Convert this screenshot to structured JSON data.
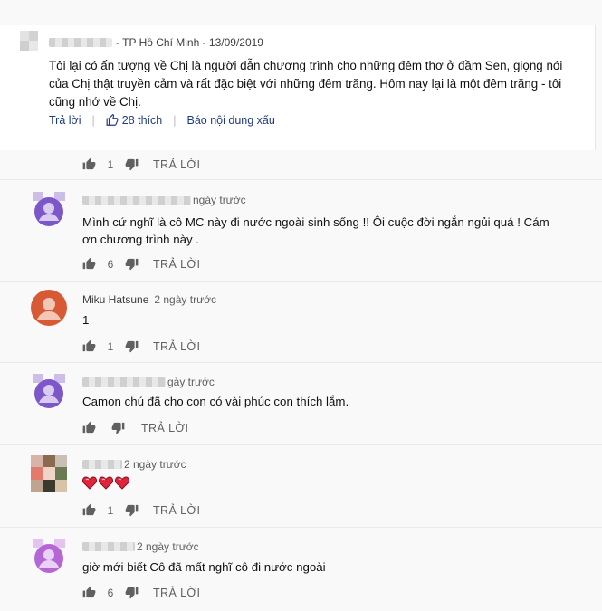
{
  "featured": {
    "location_date": "- TP Hồ Chí Minh - 13/09/2019",
    "text": "Tôi lại có ấn tượng về Chị là người dẫn chương trình cho những đêm thơ ở đầm Sen, giọng nói của Chị thật truyền cảm và rất đặc biệt với những đêm trăng. Hôm nay lại là một đêm trăng - tôi cũng nhớ về Chị.",
    "reply_label": "Trả lời",
    "likes_label": "28 thích",
    "report_label": "Báo nội dung xấu"
  },
  "reply_label": "TRẢ LỜI",
  "comments": [
    {
      "likes": "1"
    },
    {
      "time": "ngày trước",
      "text": "Mình cứ nghĩ là cô MC này đi nước ngoài sinh sống !! Ôi cuộc đời ngắn ngủi quá ! Cám ơn chương trình này .",
      "likes": "6"
    },
    {
      "name": "Miku Hatsune",
      "time": "2 ngày trước",
      "text": "1",
      "likes": "1"
    },
    {
      "time": "gày trước",
      "text": "Camon chú đã cho con có vài phúc con thích lắm.",
      "likes": ""
    },
    {
      "time": "2 ngày trước",
      "text": "",
      "likes": "1"
    },
    {
      "time": "2 ngày trước",
      "text": "giờ mới biết Cô đã mất  nghĩ cô  đi  nước ngoài",
      "likes": "6"
    }
  ],
  "colors": {
    "purple_avatar": "#7b57c9",
    "orange_avatar": "#d85a34",
    "magenta_avatar": "#b566d6",
    "link_blue": "#1f3b80"
  },
  "icons": [
    "thumb-up-icon",
    "thumb-down-icon",
    "heart-icon"
  ]
}
